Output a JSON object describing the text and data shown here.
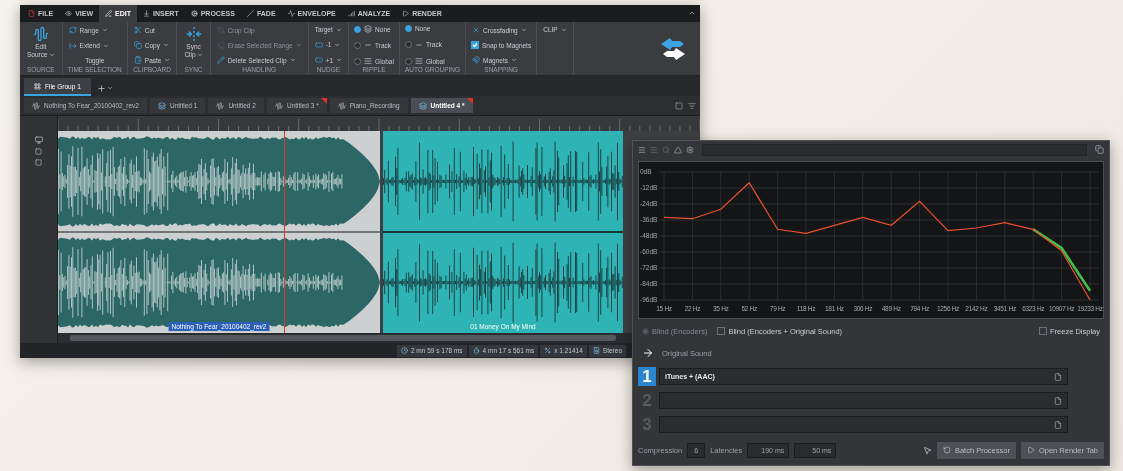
{
  "editor": {
    "menu_tabs": [
      {
        "label": "FILE",
        "selected": false
      },
      {
        "label": "VIEW",
        "selected": false
      },
      {
        "label": "EDIT",
        "selected": true
      },
      {
        "label": "INSERT",
        "selected": false
      },
      {
        "label": "PROCESS",
        "selected": false
      },
      {
        "label": "FADE",
        "selected": false
      },
      {
        "label": "ENVELOPE",
        "selected": false
      },
      {
        "label": "ANALYZE",
        "selected": false
      },
      {
        "label": "RENDER",
        "selected": false
      }
    ],
    "ribbon_groups": [
      {
        "label": "SOURCE",
        "items": [
          {
            "kind": "big",
            "lines": [
              "Edit",
              "Source"
            ],
            "dropdown": true
          }
        ]
      },
      {
        "label": "TIME SELECTION",
        "items": [
          {
            "kind": "small",
            "label": "Range",
            "dropdown": true
          },
          {
            "kind": "small",
            "label": "Extend",
            "dropdown": true
          },
          {
            "kind": "text",
            "label": "Toggle",
            "dropdown": false
          }
        ]
      },
      {
        "label": "CLIPBOARD",
        "items": [
          {
            "kind": "small",
            "label": "Cut",
            "dropdown": false
          },
          {
            "kind": "small",
            "label": "Copy",
            "dropdown": true
          },
          {
            "kind": "small",
            "label": "Paste",
            "dropdown": true
          }
        ]
      },
      {
        "label": "SYNC",
        "items": [
          {
            "kind": "big",
            "lines": [
              "Sync",
              "Clip"
            ],
            "dropdown": true
          }
        ]
      },
      {
        "label": "HANDLING",
        "items": [
          {
            "kind": "small",
            "label": "Crop Clip",
            "dropdown": false,
            "disabled": true
          },
          {
            "kind": "small",
            "label": "Erase Selected Range",
            "dropdown": true,
            "disabled": true
          },
          {
            "kind": "small",
            "label": "Delete Selected Clip",
            "dropdown": true,
            "disabled": false
          }
        ]
      },
      {
        "label": "NUDGE",
        "items": [
          {
            "kind": "text",
            "label": "Target",
            "dropdown": true
          },
          {
            "kind": "small",
            "label": "-1",
            "dropdown": true
          },
          {
            "kind": "small",
            "label": "+1",
            "dropdown": true
          }
        ]
      },
      {
        "label": "RIPPLE",
        "items": [
          {
            "kind": "radio",
            "label": "None",
            "selected": true
          },
          {
            "kind": "radio",
            "label": "Track",
            "selected": false
          },
          {
            "kind": "radio",
            "label": "Global",
            "selected": false
          }
        ]
      },
      {
        "label": "AUTO GROUPING",
        "items": [
          {
            "kind": "radio",
            "label": "None",
            "selected": true
          },
          {
            "kind": "radio",
            "label": "Track",
            "selected": false
          },
          {
            "kind": "radio",
            "label": "Global",
            "selected": false
          }
        ]
      },
      {
        "label": "SNAPPING",
        "items": [
          {
            "kind": "small",
            "label": "Crossfading",
            "dropdown": true
          },
          {
            "kind": "check",
            "label": "Snap to Magnets",
            "checked": true
          },
          {
            "kind": "small",
            "label": "Magnets",
            "dropdown": true
          }
        ]
      },
      {
        "items": [
          {
            "kind": "text",
            "label": "CLIP",
            "dropdown": true
          }
        ]
      }
    ],
    "file_group_tabs": [
      {
        "label": "File Group 1",
        "selected": true
      }
    ],
    "file_tabs": [
      {
        "kind": "audio",
        "label": "Nothing To Fear_20100402_rev2",
        "selected": false,
        "modified": false
      },
      {
        "kind": "montage",
        "label": "Untitled 1",
        "selected": false,
        "modified": false
      },
      {
        "kind": "audio",
        "label": "Untitled 2",
        "selected": false,
        "modified": false
      },
      {
        "kind": "audio",
        "label": "Untitled 3 *",
        "selected": false,
        "modified": true
      },
      {
        "kind": "audio",
        "label": "Piano_Recording",
        "selected": false,
        "modified": false
      },
      {
        "kind": "montage",
        "label": "Untitled 4 *",
        "selected": true,
        "modified": true
      }
    ],
    "clips": [
      {
        "label": "Nothing To Fear_20100402_rev2",
        "selected": true
      },
      {
        "label": "01 Money On My Mind",
        "selected": false
      }
    ],
    "status_items": [
      "2 mn 59 s 178 ms",
      "4 mn 17 s 561 ms",
      "x 1.21414",
      "Stereo"
    ]
  },
  "analyzer": {
    "chart_data": {
      "type": "line",
      "categories": [
        "15 Hz",
        "22 Hz",
        "35 Hz",
        "52 Hz",
        "79 Hz",
        "118 Hz",
        "181 Hz",
        "306 Hz",
        "489 Hz",
        "794 Hz",
        "1256 Hz",
        "2142 Hz",
        "3451 Hz",
        "6323 Hz",
        "10907 Hz",
        "19233 Hz"
      ],
      "grid": true,
      "series": [
        {
          "color": "#3fbf4a",
          "values": [
            null,
            null,
            null,
            null,
            null,
            null,
            null,
            null,
            null,
            null,
            null,
            null,
            null,
            -43,
            -57,
            -89
          ]
        },
        {
          "color": "#e8502e",
          "values": [
            -34,
            -35,
            -28,
            -8,
            -43,
            -46,
            -40,
            -34,
            -40,
            -22,
            -44,
            -42,
            -38,
            -43,
            -59,
            -96
          ]
        }
      ],
      "ylim": [
        -96,
        0
      ],
      "yticks": [
        {
          "value": 0,
          "label": "0dB"
        },
        {
          "value": -12,
          "label": "-12dB"
        },
        {
          "value": -24,
          "label": "-24dB"
        },
        {
          "value": -36,
          "label": "-36dB"
        },
        {
          "value": -48,
          "label": "-48dB"
        },
        {
          "value": -60,
          "label": "-60dB"
        },
        {
          "value": -72,
          "label": "-72dB"
        },
        {
          "value": -84,
          "label": "-84dB"
        },
        {
          "value": -96,
          "label": "-96dB"
        }
      ]
    },
    "options": [
      {
        "kind": "radio",
        "label": "Blind (Encoders)",
        "selected": false,
        "disabled": true
      },
      {
        "kind": "check",
        "label": "Blind (Encoders + Original Sound)",
        "checked": false
      },
      {
        "kind": "check",
        "label": "Freeze Display",
        "checked": false
      }
    ],
    "reference": {
      "label": "Original Sound"
    },
    "slots": [
      {
        "number": "1",
        "value": "iTunes + (AAC)",
        "selected": true
      },
      {
        "number": "2",
        "selected": false
      },
      {
        "number": "3",
        "selected": false
      }
    ],
    "compression": {
      "label": "Compression",
      "value": "6"
    },
    "latencies": {
      "label": "Latencies",
      "values": [
        "190 ms",
        "50 ms"
      ]
    },
    "buttons": [
      {
        "label": "Batch Processor"
      },
      {
        "label": "Open Render Tab"
      }
    ]
  }
}
